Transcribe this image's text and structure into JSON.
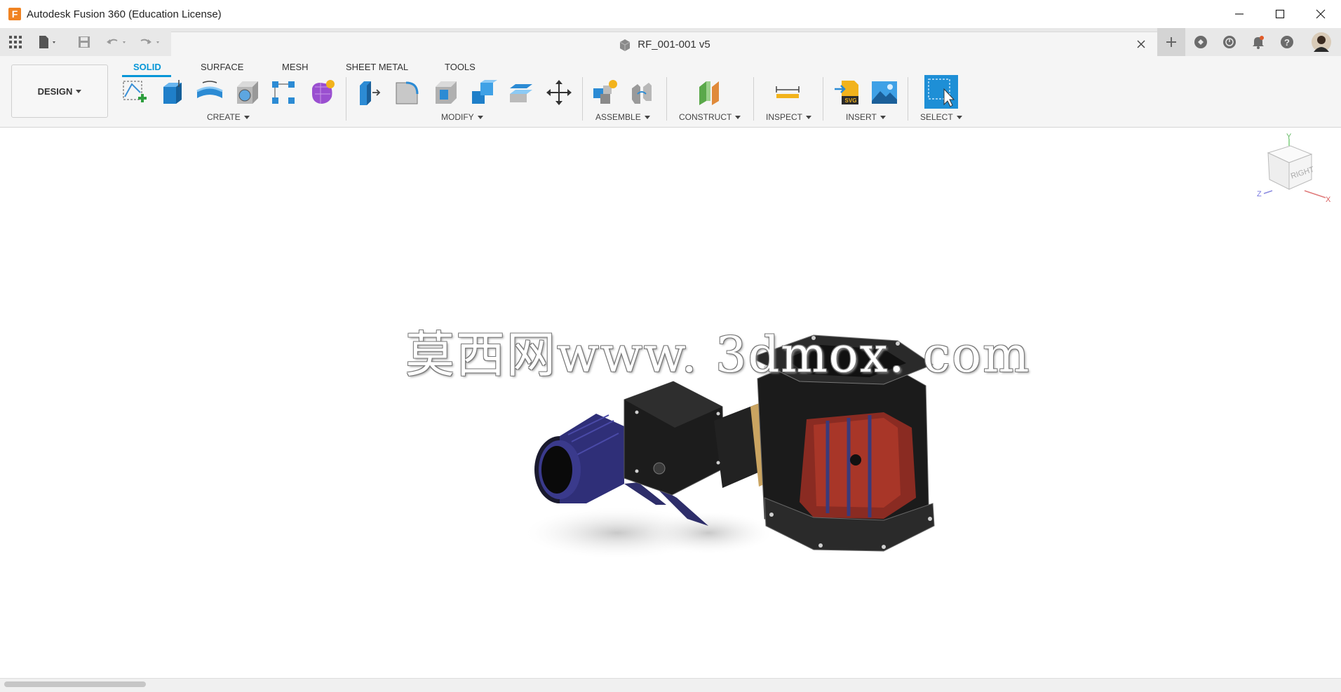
{
  "window": {
    "app_title": "Autodesk Fusion 360 (Education License)",
    "logo_letter": "F",
    "controls": [
      "minimize-icon",
      "maximize-icon",
      "close-icon"
    ]
  },
  "tabbar": {
    "quick_access": [
      "grid-apps-icon",
      "file-icon",
      "save-icon",
      "undo-icon",
      "redo-icon"
    ],
    "document_title": "RF_001-001 v5",
    "right_icons": [
      "new-tab-icon",
      "extensions-icon",
      "job-status-icon",
      "notifications-icon",
      "help-icon",
      "profile-avatar"
    ]
  },
  "toolbar": {
    "workspace": "DESIGN",
    "tabs": [
      "SOLID",
      "SURFACE",
      "MESH",
      "SHEET METAL",
      "TOOLS"
    ],
    "active_tab": "SOLID",
    "groups": {
      "create": "CREATE",
      "modify": "MODIFY",
      "assemble": "ASSEMBLE",
      "construct": "CONSTRUCT",
      "inspect": "INSPECT",
      "insert": "INSERT",
      "select": "SELECT"
    },
    "accent_color": "#0696d7"
  },
  "viewcube": {
    "face": "RIGHT",
    "axis_y": "Y",
    "axis_x": "X",
    "axis_z": "Z"
  },
  "watermark": "莫西网www. 3dmox. com"
}
